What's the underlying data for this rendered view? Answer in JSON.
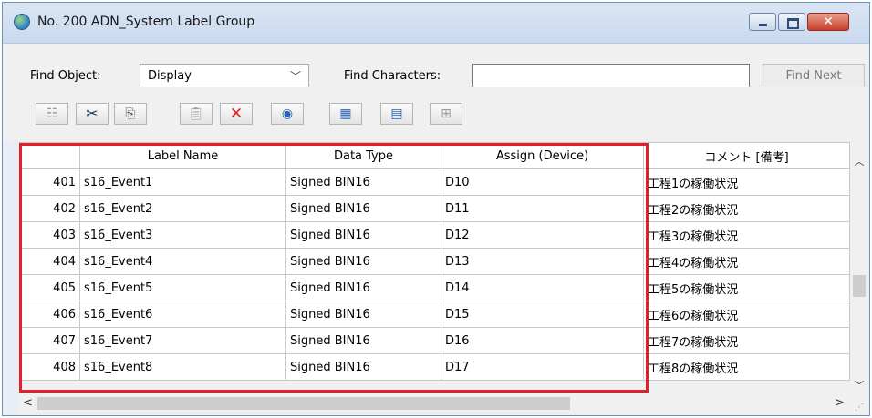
{
  "window": {
    "title": "No. 200 ADN_System Label Group"
  },
  "find": {
    "object_label": "Find Object:",
    "object_value": "Display",
    "chars_label": "Find Characters:",
    "chars_value": "",
    "next_label": "Find Next"
  },
  "toolbar": {
    "icons": [
      "properties-icon",
      "cut-icon",
      "copy-icon",
      "paste-icon",
      "delete-icon",
      "import-icon",
      "export-icon",
      "export-excel-icon",
      "layout-icon"
    ]
  },
  "table": {
    "columns": [
      "",
      "Label Name",
      "Data Type",
      "Assign (Device)",
      "コメント [備考]"
    ],
    "rows": [
      [
        "401",
        "s16_Event1",
        "Signed BIN16",
        "D10",
        "工程1の稼働状況"
      ],
      [
        "402",
        "s16_Event2",
        "Signed BIN16",
        "D11",
        "工程2の稼働状況"
      ],
      [
        "403",
        "s16_Event3",
        "Signed BIN16",
        "D12",
        "工程3の稼働状況"
      ],
      [
        "404",
        "s16_Event4",
        "Signed BIN16",
        "D13",
        "工程4の稼働状況"
      ],
      [
        "405",
        "s16_Event5",
        "Signed BIN16",
        "D14",
        "工程5の稼働状況"
      ],
      [
        "406",
        "s16_Event6",
        "Signed BIN16",
        "D15",
        "工程6の稼働状況"
      ],
      [
        "407",
        "s16_Event7",
        "Signed BIN16",
        "D16",
        "工程7の稼働状況"
      ],
      [
        "408",
        "s16_Event8",
        "Signed BIN16",
        "D17",
        "工程8の稼働状況"
      ]
    ]
  },
  "colors": {
    "highlight": "#e1202a",
    "title_bar": "#c9d9ee",
    "close_button": "#c7402b"
  }
}
